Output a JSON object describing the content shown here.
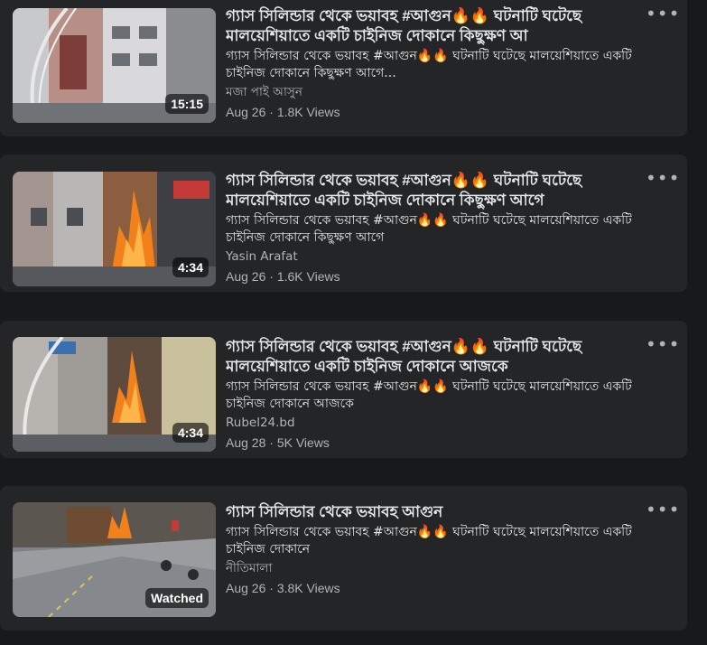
{
  "videos": [
    {
      "title": "গ্যাস সিলিন্ডার থেকে ভয়াবহ #আগুন🔥🔥 ঘটনাটি ঘটেছে মালয়েশিয়াতে একটি চাইনিজ দোকানে কিছুক্ষণ আ",
      "description": "গ্যাস সিলিন্ডার থেকে ভয়াবহ #আগুন🔥🔥 ঘটনাটি ঘটেছে মালয়েশিয়াতে একটি চাইনিজ দোকানে কিছুক্ষণ আগে...",
      "channel": "মজা পাই আসুন",
      "date": "Aug 26",
      "views": "1.8K Views",
      "duration": "15:15",
      "more_icon": "more-options-icon"
    },
    {
      "title": "গ্যাস সিলিন্ডার থেকে ভয়াবহ #আগুন🔥🔥 ঘটনাটি ঘটেছে মালয়েশিয়াতে একটি চাইনিজ দোকানে কিছুক্ষণ আগে",
      "description": "গ্যাস সিলিন্ডার থেকে ভয়াবহ #আগুন🔥🔥 ঘটনাটি ঘটেছে মালয়েশিয়াতে একটি চাইনিজ দোকানে কিছুক্ষণ আগে",
      "channel": "Yasin Arafat",
      "date": "Aug 26",
      "views": "1.6K Views",
      "duration": "4:34",
      "more_icon": "more-options-icon"
    },
    {
      "title": "গ্যাস সিলিন্ডার থেকে ভয়াবহ #আগুন🔥🔥 ঘটনাটি ঘটেছে মালয়েশিয়াতে একটি চাইনিজ দোকানে আজকে",
      "description": "গ্যাস সিলিন্ডার থেকে ভয়াবহ #আগুন🔥🔥 ঘটনাটি ঘটেছে মালয়েশিয়াতে একটি চাইনিজ দোকানে আজকে",
      "channel": "Rubel24.bd",
      "date": "Aug 28",
      "views": "5K Views",
      "duration": "4:34",
      "more_icon": "more-options-icon"
    },
    {
      "title": "গ্যাস সিলিন্ডার থেকে ভয়াবহ আগুন",
      "description": "গ্যাস সিলিন্ডার থেকে ভয়াবহ #আগুন🔥🔥 ঘটনাটি ঘটেছে মালয়েশিয়াতে একটি চাইনিজ দোকানে",
      "channel": "নীতিমালা",
      "date": "Aug 26",
      "views": "3.8K Views",
      "duration": "Watched",
      "more_icon": "more-options-icon"
    }
  ],
  "meta_separator": " · ",
  "more_label": "•••"
}
